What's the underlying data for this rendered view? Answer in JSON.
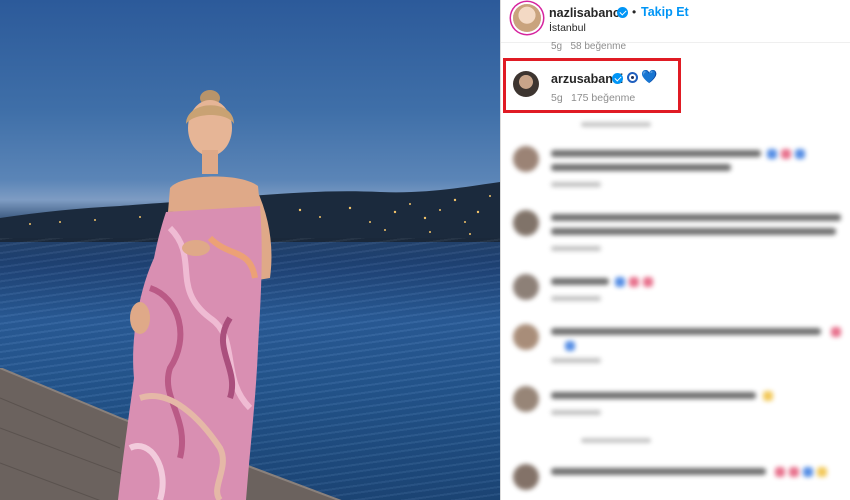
{
  "post": {
    "username": "nazlisabanci",
    "follow_separator": "•",
    "follow_label": "Takip Et",
    "location": "İstanbul"
  },
  "previous_comment": {
    "meta": "5g   58 beğenme"
  },
  "highlighted_comment": {
    "username": "arzusabanci",
    "heart": "💙",
    "time": "5g",
    "likes": "175 beğenme"
  },
  "colors": {
    "accent": "#0095f6",
    "highlight": "#e01b24",
    "verified": "#0095f6"
  },
  "icons": [
    "verified-badge-icon",
    "nazar-boncugu-icon",
    "blue-heart-icon"
  ]
}
